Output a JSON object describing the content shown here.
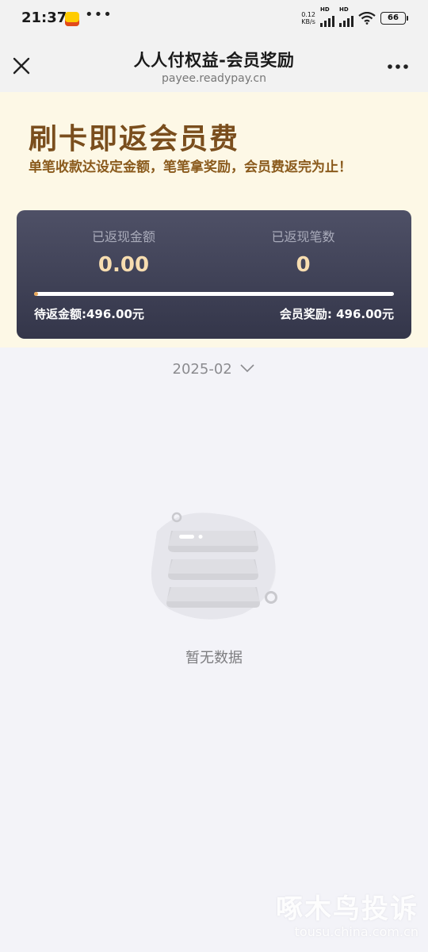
{
  "status_bar": {
    "time": "21:37",
    "app_icon_text": "美团",
    "net_speed_value": "0.12",
    "net_speed_unit": "KB/s",
    "signal_label_1": "HD",
    "signal_label_2": "HD",
    "battery": "66"
  },
  "browser": {
    "title": "人人付权益-会员奖励",
    "url": "payee.readypay.cn"
  },
  "banner": {
    "title": "刷卡即返会员费",
    "subtitle": "单笔收款达设定金额，笔笔拿奖励，会员费返完为止！"
  },
  "stats": {
    "returned_amount_label": "已返现金额",
    "returned_amount_value": "0.00",
    "returned_count_label": "已返现笔数",
    "returned_count_value": "0",
    "progress_fraction": 0.0,
    "pending_amount": "待返金额:496.00元",
    "member_reward": "会员奖励: 496.00元"
  },
  "filter": {
    "month": "2025-02"
  },
  "empty_state": {
    "text": "暂无数据"
  },
  "watermark": {
    "title": "啄木鸟投诉",
    "url": "tousu.china.com.cn"
  },
  "colors": {
    "banner_bg": "#fdf8e6",
    "title_brown": "#7a4e1d",
    "card_top": "#4e5066",
    "card_bottom": "#34364a",
    "value_gold": "#f7ddb0",
    "progress_accent": "#e9a85a",
    "page_bg": "#f3f3f8"
  }
}
